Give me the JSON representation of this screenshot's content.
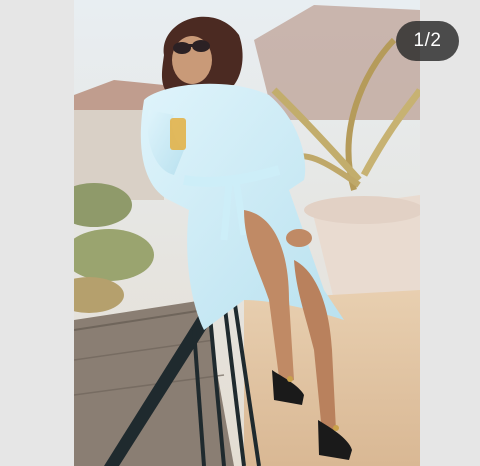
{
  "viewer": {
    "counter": "1/2"
  },
  "colors": {
    "page_background": "#e6e6e6",
    "counter_background": "#2a2a2a",
    "counter_text": "#ffffff"
  }
}
